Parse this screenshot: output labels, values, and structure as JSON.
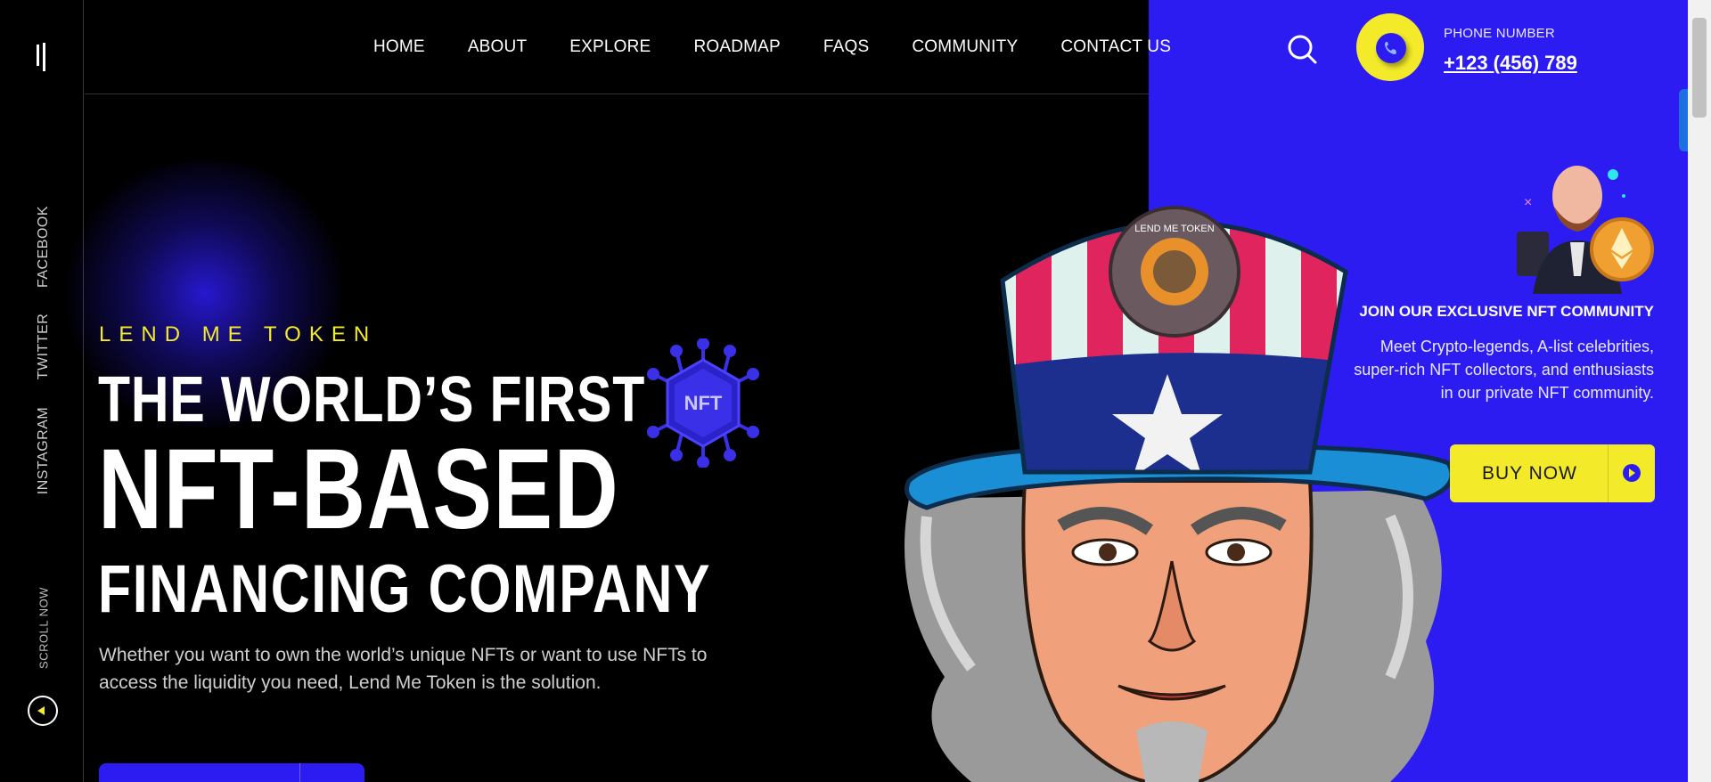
{
  "nav": {
    "items": [
      "HOME",
      "ABOUT",
      "EXPLORE",
      "ROADMAP",
      "FAQS",
      "COMMUNITY",
      "CONTACT US"
    ]
  },
  "social": {
    "facebook": "FACEBOOK",
    "twitter": "TWITTER",
    "instagram": "INSTAGRAM"
  },
  "scroll": {
    "label": "SCROLL NOW"
  },
  "contact": {
    "phone_label": "PHONE NUMBER",
    "phone_number": "+123 (456) 789"
  },
  "hero": {
    "eyebrow": "LEND ME TOKEN",
    "line1": "THE WORLD’S FIRST",
    "line2": "NFT-BASED",
    "line3": "FINANCING COMPANY",
    "text": "Whether you want to own the world’s unique NFTs or want to use NFTs to access the liquidity you need, Lend Me Token is the solution."
  },
  "badge": {
    "nft_label": "NFT",
    "token_ring": "LEND ME TOKEN"
  },
  "community": {
    "title": "JOIN OUR EXCLUSIVE NFT COMMUNITY",
    "text": "Meet Crypto-legends, A-list celebrities, super-rich NFT collectors, and enthusiasts in our private NFT community.",
    "button": "BUY NOW"
  },
  "colors": {
    "accent_blue": "#2d1cf2",
    "accent_yellow": "#f3ea2a",
    "background": "#000000"
  }
}
